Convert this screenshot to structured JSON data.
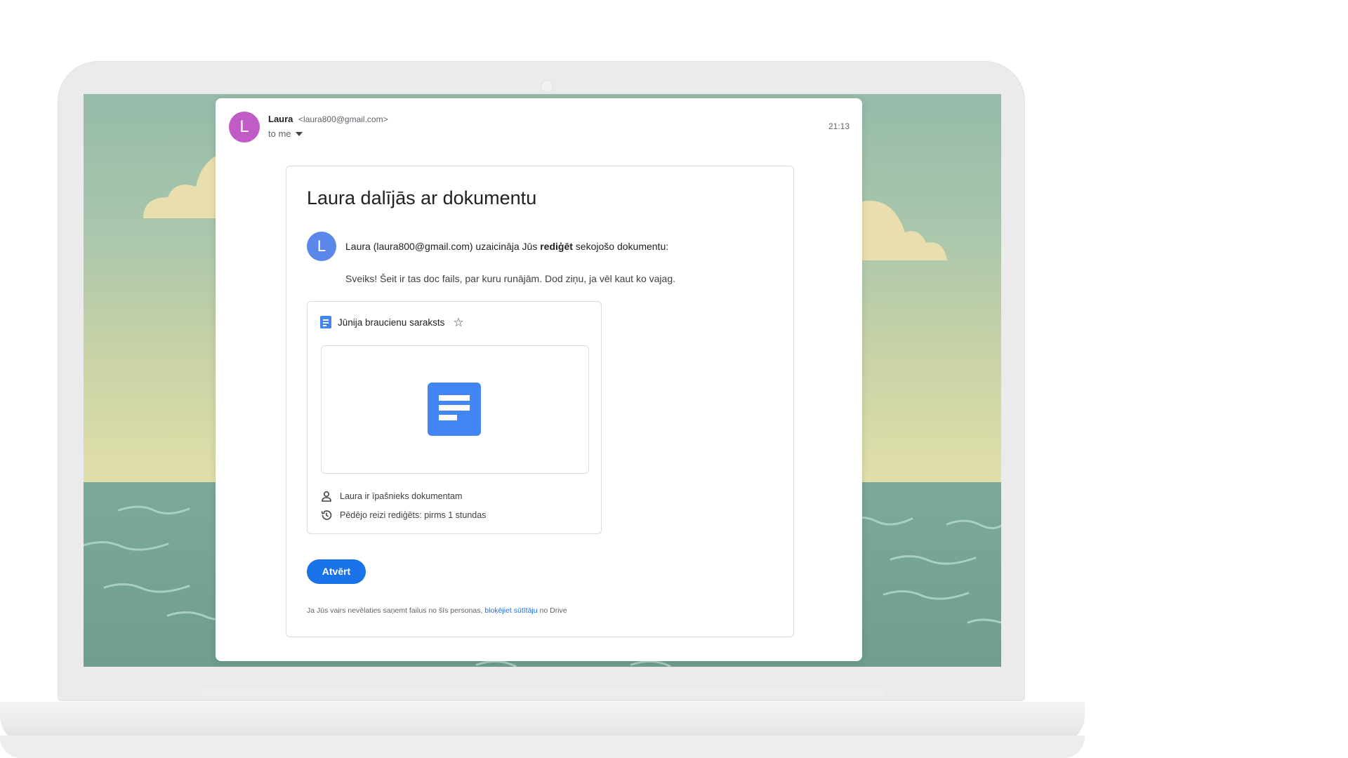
{
  "email": {
    "sender_initial": "L",
    "sender_name": "Laura",
    "sender_email": "<laura800@gmail.com>",
    "to_label": "to me",
    "time": "21:13"
  },
  "share_card": {
    "title": "Laura dalījās ar dokumentu",
    "avatar_initial": "L",
    "invite_prefix": "Laura (laura800@gmail.com) uzaicināja Jūs ",
    "invite_bold": "rediģēt",
    "invite_suffix": " sekojošo dokumentu:",
    "message": "Sveiks! Šeit ir tas doc fails, par kuru runājām. Dod ziņu, ja vēl kaut ko vajag.",
    "document": {
      "name": "Jūnija braucienu saraksts",
      "owner_text": "Laura ir īpašnieks dokumentam",
      "last_edited_text": "Pēdējo reizi rediģēts: pirms 1 stundas"
    },
    "open_button": "Atvērt",
    "footer_prefix": "Ja Jūs vairs nevēlaties saņemt failus no šīs personas, ",
    "footer_link": "bloķējiet sūtītāju",
    "footer_suffix": " no Drive"
  },
  "colors": {
    "sender_avatar": "#c15bc5",
    "share_avatar": "#5a87e8",
    "docs_blue": "#4285f4",
    "button_blue": "#1a73e8"
  },
  "icons": [
    "caret-down-icon",
    "docs-icon",
    "star-icon",
    "person-icon",
    "history-icon"
  ]
}
